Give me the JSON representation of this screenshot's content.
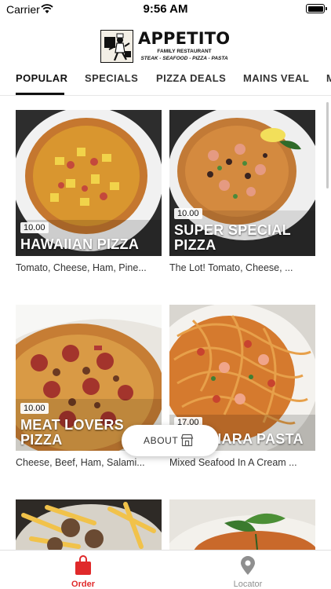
{
  "status": {
    "carrier": "Carrier",
    "time": "9:56 AM"
  },
  "logo": {
    "name": "APPETITO",
    "line1": "FAMILY RESTAURANT",
    "line2": "STEAK - SEAFOOD - PIZZA - PASTA"
  },
  "tabs": [
    {
      "label": "POPULAR",
      "active": true
    },
    {
      "label": "SPECIALS",
      "active": false
    },
    {
      "label": "PIZZA DEALS",
      "active": false
    },
    {
      "label": "MAINS VEAL",
      "active": false
    },
    {
      "label": "M",
      "active": false
    }
  ],
  "items": [
    {
      "price": "10.00",
      "title": "HAWAIIAN PIZZA",
      "description": "Tomato, Cheese, Ham, Pine..."
    },
    {
      "price": "10.00",
      "title_line1": "SUPER SPECIAL",
      "title_line2": "PIZZA",
      "description": "The Lot! Tomato, Cheese, ..."
    },
    {
      "price": "10.00",
      "title_line1": "MEAT LOVERS",
      "title_line2": "PIZZA",
      "description": "Cheese, Beef, Ham, Salami..."
    },
    {
      "price": "17.00",
      "title": "MARINARA PASTA",
      "description": "Mixed Seafood In A Cream ..."
    },
    {
      "title": "",
      "description": ""
    },
    {
      "title": "",
      "description": ""
    }
  ],
  "about": {
    "label": "ABOUT",
    "icon": "store-icon"
  },
  "nav": [
    {
      "label": "Order",
      "icon": "shopping-bag-icon",
      "color": "#e0292a"
    },
    {
      "label": "Locator",
      "icon": "map-pin-icon",
      "color": "#8f8f8f"
    }
  ]
}
